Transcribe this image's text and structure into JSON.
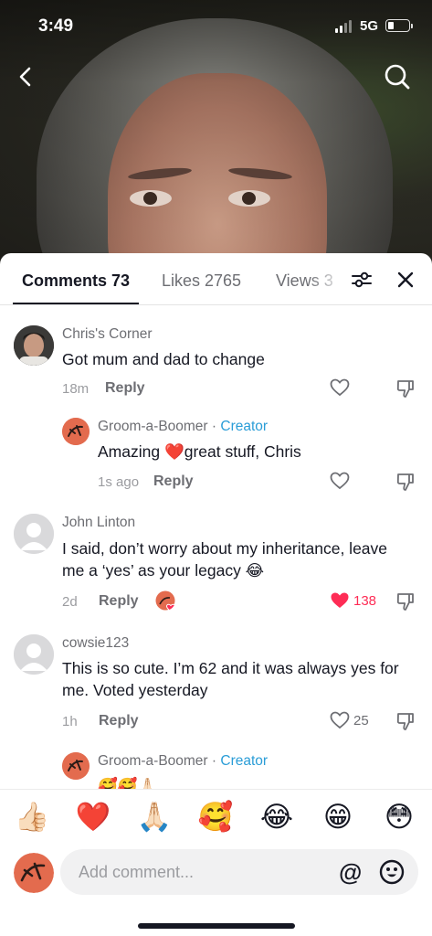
{
  "status_bar": {
    "time": "3:49",
    "network": "5G"
  },
  "tabs": [
    {
      "label": "Comments 73",
      "active": true
    },
    {
      "label": "Likes 2765",
      "active": false
    },
    {
      "label": "Views 3",
      "active": false
    }
  ],
  "comments": [
    {
      "user": "Chris's Corner",
      "text": "Got mum and dad to change",
      "time": "18m",
      "reply": "Reply",
      "likes": ""
    },
    {
      "user": "Groom-a-Boomer",
      "badge": "Creator",
      "sep": "·",
      "text": "Amazing ❤️great stuff, Chris",
      "time": "1s ago",
      "reply": "Reply",
      "likes": ""
    },
    {
      "user": "John Linton",
      "text": "I said, don’t worry about my inheritance, leave me a ‘yes’ as your legacy 😂",
      "time": "2d",
      "reply": "Reply",
      "likes": "138",
      "liked": true
    },
    {
      "user": "cowsie123",
      "text": "This is so cute. I’m 62 and it was always yes for me. Voted yesterday",
      "time": "1h",
      "reply": "Reply",
      "likes": "25"
    },
    {
      "user": "Groom-a-Boomer",
      "badge": "Creator",
      "sep": "·",
      "text": "🥰🥰🙏🏻"
    }
  ],
  "quick_emojis": [
    "👍🏻",
    "❤️",
    "🙏🏻",
    "🥰",
    "😂",
    "😁",
    "😳"
  ],
  "input": {
    "placeholder": "Add comment...",
    "at_symbol": "@"
  },
  "colors": {
    "like_red": "#fe2c55",
    "creator_blue": "#2a9dd7",
    "text_dark": "#161823",
    "text_muted": "#6d6e73"
  }
}
